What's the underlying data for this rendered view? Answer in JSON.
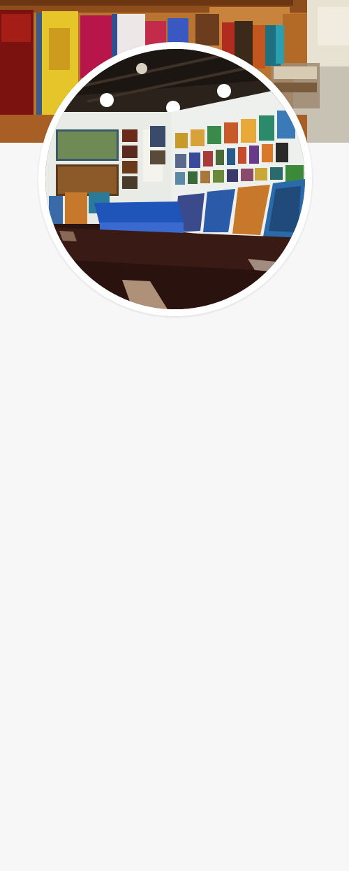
{
  "profile": {
    "cover_image": "shop-interior-clothing-racks",
    "avatar_image": "gallery-interior-batik-paintings"
  },
  "colors": {
    "page_background": "#f7f7f7",
    "avatar_border": "#ffffff"
  }
}
